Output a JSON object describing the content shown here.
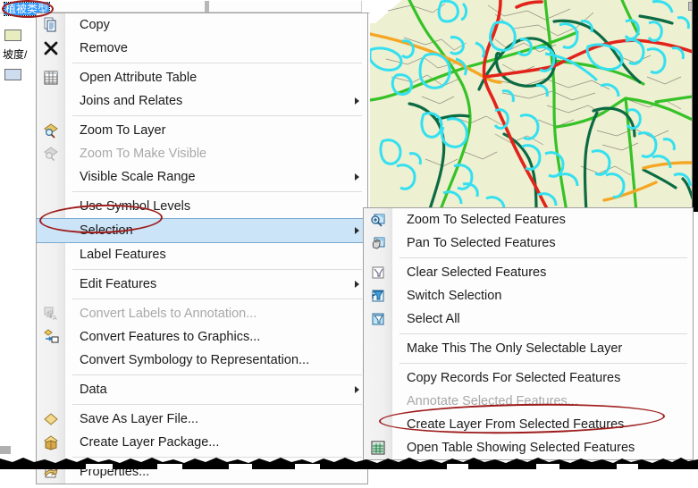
{
  "app": {
    "name": "ArcMap",
    "accent_selection": "#cce4f7",
    "annotation_color": "#9e1b1b",
    "map_background": "#eef0d2"
  },
  "toc": {
    "layer_name": "植被类型",
    "sub_label": "坡度/",
    "swatch_1_color": "#e8edc0",
    "swatch_2_color": "#cddcef"
  },
  "context_menu": {
    "items": [
      {
        "label": "Copy",
        "icon": "copy-icon",
        "disabled": false,
        "submenu": false,
        "sep_after": false
      },
      {
        "label": "Remove",
        "icon": "remove-x-icon",
        "disabled": false,
        "submenu": false,
        "sep_after": true
      },
      {
        "label": "Open Attribute Table",
        "icon": "table-icon",
        "disabled": false,
        "submenu": false,
        "sep_after": false
      },
      {
        "label": "Joins and Relates",
        "icon": "none",
        "disabled": false,
        "submenu": true,
        "sep_after": true
      },
      {
        "label": "Zoom To Layer",
        "icon": "zoom-to-layer-icon",
        "disabled": false,
        "submenu": false,
        "sep_after": false
      },
      {
        "label": "Zoom To Make Visible",
        "icon": "zoom-visible-icon",
        "disabled": true,
        "submenu": false,
        "sep_after": false
      },
      {
        "label": "Visible Scale Range",
        "icon": "none",
        "disabled": false,
        "submenu": true,
        "sep_after": true
      },
      {
        "label": "Use Symbol Levels",
        "icon": "none",
        "disabled": false,
        "submenu": false,
        "sep_after": false
      },
      {
        "label": "Selection",
        "icon": "none",
        "disabled": false,
        "submenu": true,
        "sep_after": false,
        "selected": true
      },
      {
        "label": "Label Features",
        "icon": "none",
        "disabled": false,
        "submenu": false,
        "sep_after": true
      },
      {
        "label": "Edit Features",
        "icon": "none",
        "disabled": false,
        "submenu": true,
        "sep_after": true
      },
      {
        "label": "Convert Labels to Annotation...",
        "icon": "convert-labels-icon",
        "disabled": true,
        "submenu": false,
        "sep_after": false
      },
      {
        "label": "Convert Features to Graphics...",
        "icon": "convert-graphics-icon",
        "disabled": false,
        "submenu": false,
        "sep_after": false
      },
      {
        "label": "Convert Symbology to Representation...",
        "icon": "none",
        "disabled": false,
        "submenu": false,
        "sep_after": true
      },
      {
        "label": "Data",
        "icon": "none",
        "disabled": false,
        "submenu": true,
        "sep_after": true
      },
      {
        "label": "Save As Layer File...",
        "icon": "layer-file-icon",
        "disabled": false,
        "submenu": false,
        "sep_after": false
      },
      {
        "label": "Create Layer Package...",
        "icon": "layer-package-icon",
        "disabled": false,
        "submenu": false,
        "sep_after": true
      },
      {
        "label": "Properties...",
        "icon": "properties-icon",
        "disabled": false,
        "submenu": false,
        "sep_after": false
      }
    ]
  },
  "selection_submenu": {
    "items": [
      {
        "label": "Zoom To Selected Features",
        "icon": "zoom-selected-icon",
        "disabled": false,
        "sep_after": false
      },
      {
        "label": "Pan To Selected Features",
        "icon": "pan-selected-icon",
        "disabled": false,
        "sep_after": true
      },
      {
        "label": "Clear Selected Features",
        "icon": "clear-selection-icon",
        "disabled": false,
        "sep_after": false
      },
      {
        "label": "Switch Selection",
        "icon": "switch-selection-icon",
        "disabled": false,
        "sep_after": false
      },
      {
        "label": "Select All",
        "icon": "select-all-icon",
        "disabled": false,
        "sep_after": true
      },
      {
        "label": "Make This The Only Selectable Layer",
        "icon": "none",
        "disabled": false,
        "sep_after": true
      },
      {
        "label": "Copy Records For Selected Features",
        "icon": "none",
        "disabled": false,
        "sep_after": false
      },
      {
        "label": "Annotate Selected Features...",
        "icon": "none",
        "disabled": true,
        "sep_after": false
      },
      {
        "label": "Create Layer From Selected Features",
        "icon": "none",
        "disabled": false,
        "sep_after": false,
        "highlighted": true
      },
      {
        "label": "Open Table Showing Selected Features",
        "icon": "table-icon",
        "disabled": false,
        "sep_after": false
      }
    ]
  },
  "map": {
    "road_red": "#e2231a",
    "road_orange": "#f5a623",
    "road_green_bright": "#35c227",
    "road_green_dark": "#0b6b43",
    "selection_cyan": "#34e0f0",
    "parcel_outline": "#8a8a7a"
  }
}
